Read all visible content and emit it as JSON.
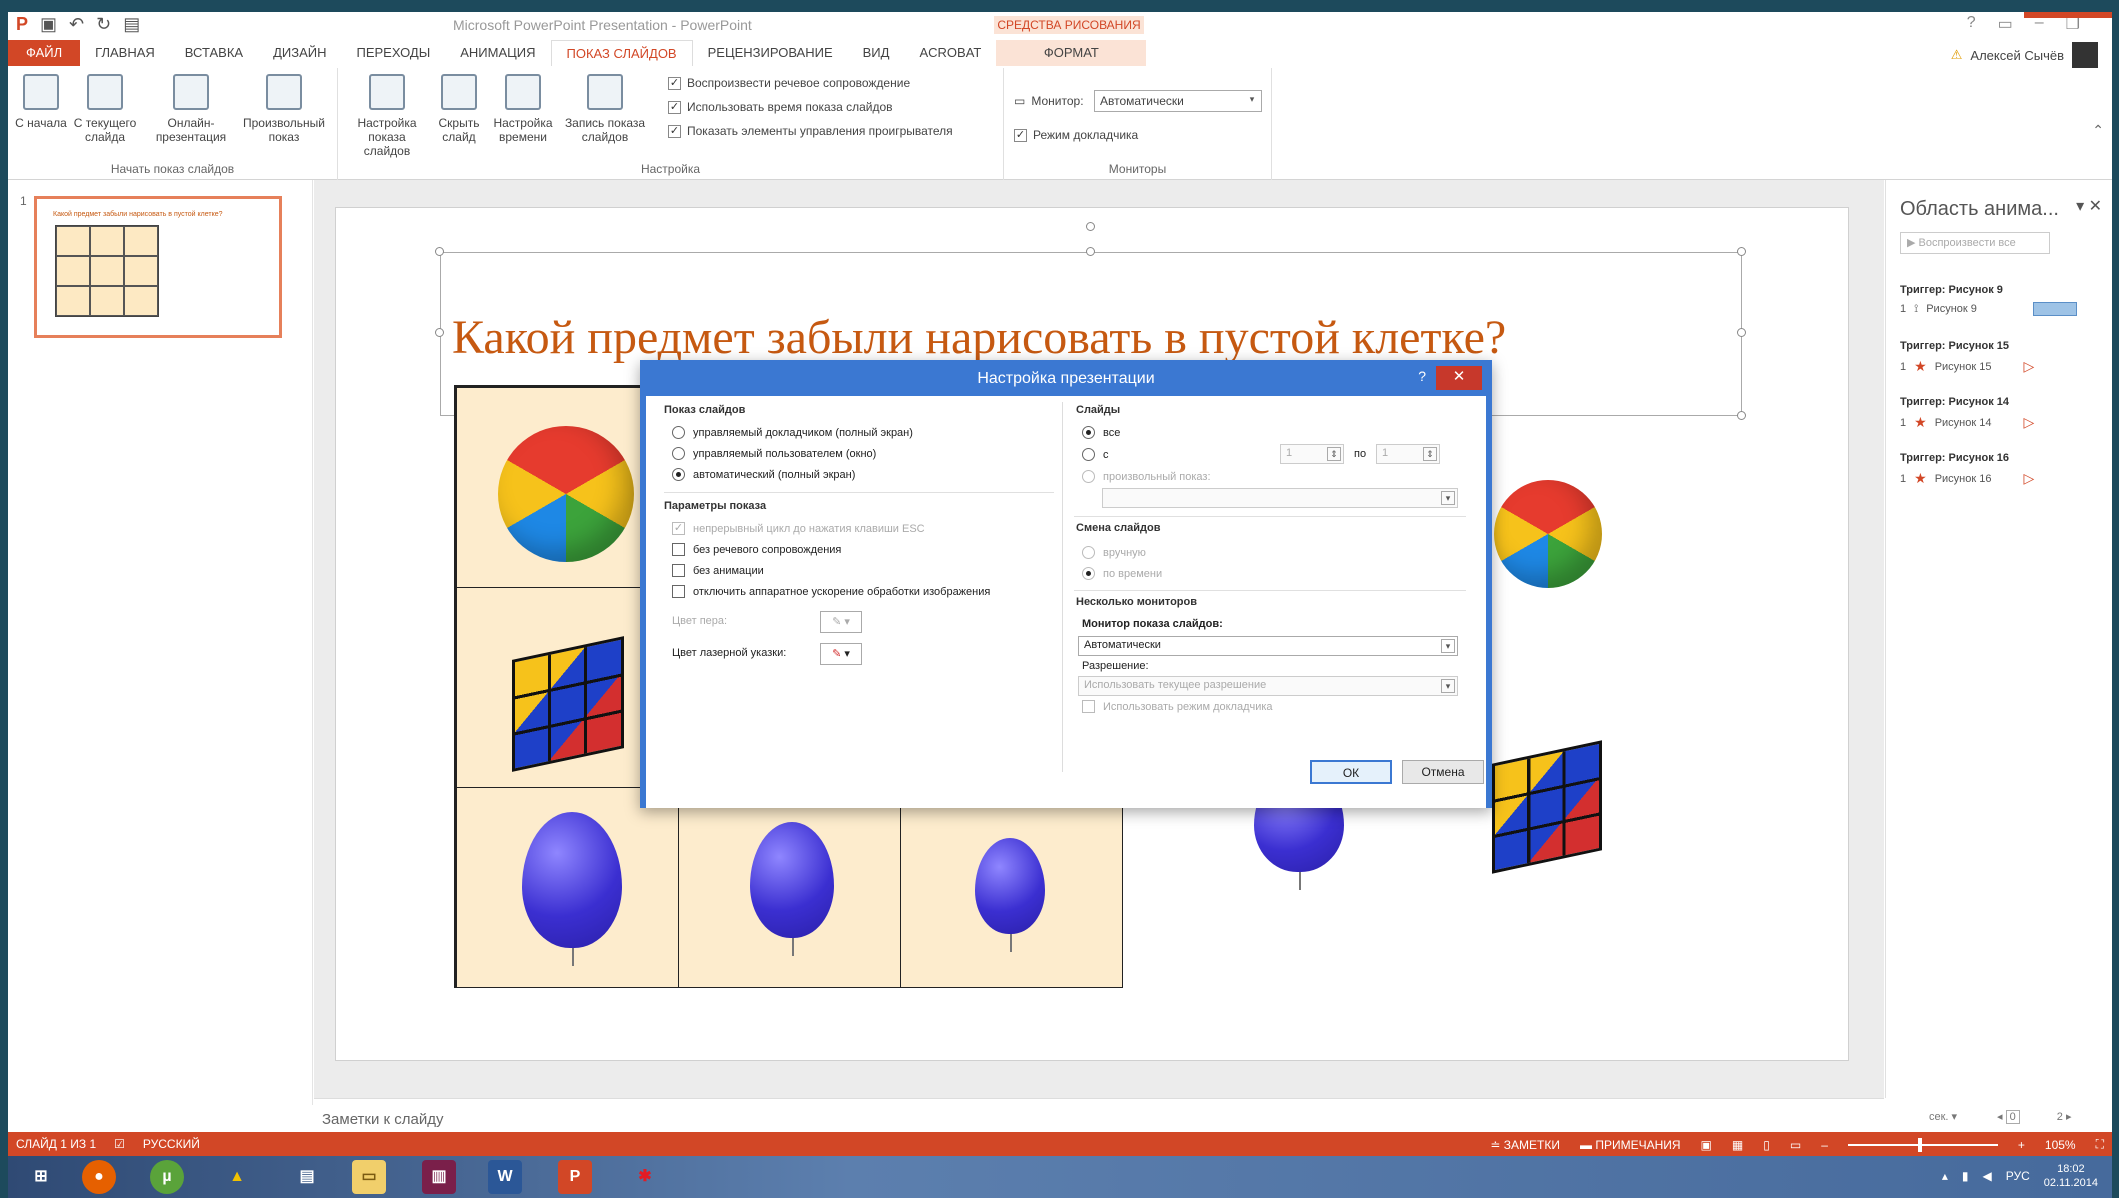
{
  "window": {
    "title": "Microsoft PowerPoint Presentation - PowerPoint",
    "context_tab_title": "СРЕДСТВА РИСОВАНИЯ",
    "user": "Алексей Сычёв"
  },
  "tabs": [
    {
      "label": "ФАЙЛ"
    },
    {
      "label": "ГЛАВНАЯ"
    },
    {
      "label": "ВСТАВКА"
    },
    {
      "label": "ДИЗАЙН"
    },
    {
      "label": "ПЕРЕХОДЫ"
    },
    {
      "label": "АНИМАЦИЯ"
    },
    {
      "label": "ПОКАЗ СЛАЙДОВ"
    },
    {
      "label": "РЕЦЕНЗИРОВАНИЕ"
    },
    {
      "label": "ВИД"
    },
    {
      "label": "ACROBAT"
    },
    {
      "label": "ФОРМАТ"
    }
  ],
  "ribbon": {
    "start_group": {
      "label": "Начать показ слайдов",
      "buttons": [
        "С начала",
        "С текущего слайда",
        "Онлайн-презентация",
        "Произвольный показ"
      ]
    },
    "setup_group": {
      "label": "Настройка",
      "buttons": [
        "Настройка показа слайдов",
        "Скрыть слайд",
        "Настройка времени",
        "Запись показа слайдов"
      ],
      "checks": [
        {
          "label": "Воспроизвести речевое сопровождение",
          "checked": true
        },
        {
          "label": "Использовать время показа слайдов",
          "checked": true
        },
        {
          "label": "Показать элементы управления проигрывателя",
          "checked": true
        }
      ]
    },
    "monitors_group": {
      "label": "Мониторы",
      "monitor_label": "Монитор:",
      "monitor_value": "Автоматически",
      "presenter_label": "Режим докладчика",
      "presenter_checked": true
    }
  },
  "thumbnail": {
    "number": "1"
  },
  "slide": {
    "title": "Какой предмет забыли нарисовать в пустой клетке?"
  },
  "dialog": {
    "title": "Настройка презентации",
    "help": "?",
    "show_type": {
      "label": "Показ слайдов",
      "options": [
        {
          "label": "управляемый докладчиком (полный экран)",
          "selected": false
        },
        {
          "label": "управляемый пользователем (окно)",
          "selected": false
        },
        {
          "label": "автоматический (полный экран)",
          "selected": true
        }
      ]
    },
    "show_options": {
      "label": "Параметры показа",
      "options": [
        {
          "label": "непрерывный цикл до нажатия клавиши ESC",
          "checked": true,
          "disabled": true
        },
        {
          "label": "без речевого сопровождения",
          "checked": false,
          "disabled": false
        },
        {
          "label": "без анимации",
          "checked": false,
          "disabled": false
        },
        {
          "label": "отключить аппаратное ускорение обработки изображения",
          "checked": false,
          "disabled": false
        }
      ],
      "pen_color_label": "Цвет пера:",
      "laser_color_label": "Цвет лазерной указки:"
    },
    "slides": {
      "label": "Слайды",
      "all": "все",
      "from": "с",
      "from_value": "1",
      "to": "по",
      "to_value": "1",
      "custom": "произвольный показ:"
    },
    "advance": {
      "label": "Смена слайдов",
      "manual": "вручную",
      "timings": "по времени"
    },
    "monitors": {
      "label": "Несколько мониторов",
      "monitor_label": "Монитор показа слайдов:",
      "monitor_value": "Автоматически",
      "resolution_label": "Разрешение:",
      "resolution_value": "Использовать текущее разрешение",
      "presenter_view": "Использовать режим докладчика"
    },
    "ok": "ОК",
    "cancel": "Отмена"
  },
  "animation_pane": {
    "title": "Область анима...",
    "play": "Воспроизвести все",
    "triggers": [
      {
        "head": "Триггер: Рисунок 9",
        "num": "1",
        "item": "Рисунок 9"
      },
      {
        "head": "Триггер: Рисунок 15",
        "num": "1",
        "item": "Рисунок 15"
      },
      {
        "head": "Триггер: Рисунок 14",
        "num": "1",
        "item": "Рисунок 14"
      },
      {
        "head": "Триггер: Рисунок 16",
        "num": "1",
        "item": "Рисунок 16"
      }
    ],
    "seconds_label": "сек.",
    "timeline_0": "0",
    "timeline_2": "2"
  },
  "notes": {
    "placeholder": "Заметки к слайду"
  },
  "status": {
    "slide": "СЛАЙД 1 ИЗ 1",
    "language": "РУССКИЙ",
    "notes": "ЗАМЕТКИ",
    "comments": "ПРИМЕЧАНИЯ",
    "zoom": "105%"
  },
  "taskbar": {
    "lang": "РУС",
    "time": "18:02",
    "date": "02.11.2014"
  }
}
